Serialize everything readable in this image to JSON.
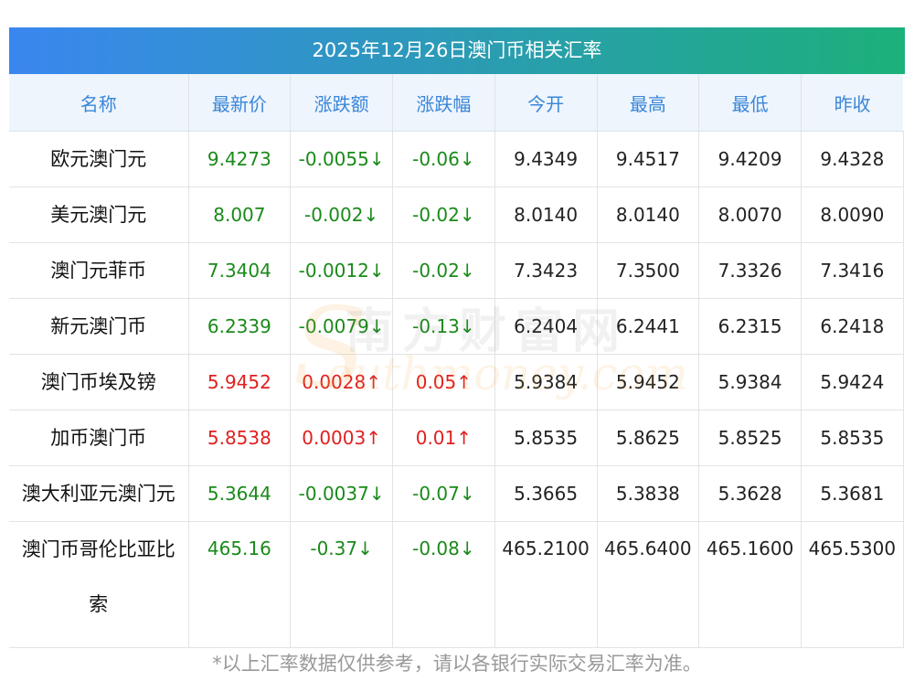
{
  "title": "2025年12月26日澳门币相关汇率",
  "headers": [
    "名称",
    "最新价",
    "涨跌额",
    "涨跌幅",
    "今开",
    "最高",
    "最低",
    "昨收"
  ],
  "rows": [
    {
      "name": "欧元澳门元",
      "latest": "9.4273",
      "change": "-0.0055↓",
      "pct": "-0.06↓",
      "open": "9.4349",
      "high": "9.4517",
      "low": "9.4209",
      "prev": "9.4328",
      "dir": "down"
    },
    {
      "name": "美元澳门元",
      "latest": "8.007",
      "change": "-0.002↓",
      "pct": "-0.02↓",
      "open": "8.0140",
      "high": "8.0140",
      "low": "8.0070",
      "prev": "8.0090",
      "dir": "down"
    },
    {
      "name": "澳门元菲币",
      "latest": "7.3404",
      "change": "-0.0012↓",
      "pct": "-0.02↓",
      "open": "7.3423",
      "high": "7.3500",
      "low": "7.3326",
      "prev": "7.3416",
      "dir": "down"
    },
    {
      "name": "新元澳门币",
      "latest": "6.2339",
      "change": "-0.0079↓",
      "pct": "-0.13↓",
      "open": "6.2404",
      "high": "6.2441",
      "low": "6.2315",
      "prev": "6.2418",
      "dir": "down"
    },
    {
      "name": "澳门币埃及镑",
      "latest": "5.9452",
      "change": "0.0028↑",
      "pct": "0.05↑",
      "open": "5.9384",
      "high": "5.9452",
      "low": "5.9384",
      "prev": "5.9424",
      "dir": "up"
    },
    {
      "name": "加币澳门币",
      "latest": "5.8538",
      "change": "0.0003↑",
      "pct": "0.01↑",
      "open": "5.8535",
      "high": "5.8625",
      "low": "5.8525",
      "prev": "5.8535",
      "dir": "up"
    },
    {
      "name": "澳大利亚元澳门元",
      "latest": "5.3644",
      "change": "-0.0037↓",
      "pct": "-0.07↓",
      "open": "5.3665",
      "high": "5.3838",
      "low": "5.3628",
      "prev": "5.3681",
      "dir": "down"
    },
    {
      "name_line1": "澳门币哥伦比亚比",
      "name_line2": "索",
      "latest": "465.16",
      "change": "-0.37↓",
      "pct": "-0.08↓",
      "open": "465.2100",
      "high": "465.6400",
      "low": "465.1600",
      "prev": "465.5300",
      "dir": "down"
    }
  ],
  "watermark": {
    "cn": "南方财富网",
    "en": "outhmoney.com",
    "s": "S"
  },
  "footnote": "*以上汇率数据仅供参考，请以各银行实际交易汇率为准。",
  "colors": {
    "up": "#e02020",
    "down": "#1a8a1a",
    "header_text": "#3a86d8",
    "title_gradient_start": "#3a86f0",
    "title_gradient_end": "#1cb07a"
  }
}
